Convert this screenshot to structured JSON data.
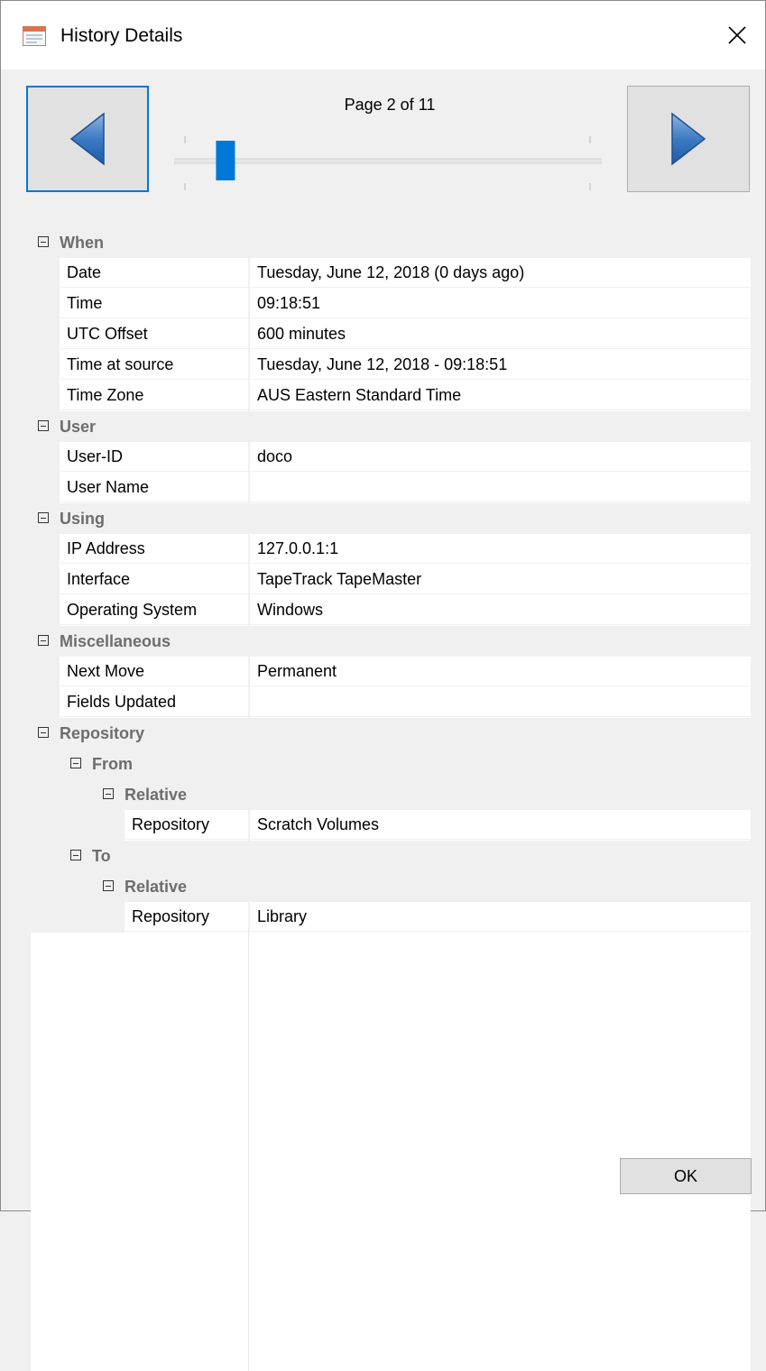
{
  "window": {
    "title": "History Details",
    "close_label": "✕"
  },
  "pager": {
    "page_label": "Page 2 of 11",
    "current_page": 2,
    "total_pages": 11
  },
  "tree": [
    {
      "type": "cat",
      "level": 0,
      "label": "When"
    },
    {
      "type": "prop",
      "level": 1,
      "name": "Date",
      "value": "Tuesday, June 12, 2018 (0 days ago)"
    },
    {
      "type": "prop",
      "level": 1,
      "name": "Time",
      "value": "09:18:51"
    },
    {
      "type": "prop",
      "level": 1,
      "name": "UTC Offset",
      "value": "600 minutes"
    },
    {
      "type": "prop",
      "level": 1,
      "name": "Time at source",
      "value": "Tuesday, June 12, 2018 - 09:18:51"
    },
    {
      "type": "prop",
      "level": 1,
      "name": "Time Zone",
      "value": "AUS Eastern Standard Time"
    },
    {
      "type": "cat",
      "level": 0,
      "label": "User"
    },
    {
      "type": "prop",
      "level": 1,
      "name": "User-ID",
      "value": "doco"
    },
    {
      "type": "prop",
      "level": 1,
      "name": "User Name",
      "value": ""
    },
    {
      "type": "cat",
      "level": 0,
      "label": "Using"
    },
    {
      "type": "prop",
      "level": 1,
      "name": "IP Address",
      "value": "127.0.0.1:1"
    },
    {
      "type": "prop",
      "level": 1,
      "name": "Interface",
      "value": "TapeTrack TapeMaster"
    },
    {
      "type": "prop",
      "level": 1,
      "name": "Operating System",
      "value": "Windows"
    },
    {
      "type": "cat",
      "level": 0,
      "label": "Miscellaneous"
    },
    {
      "type": "prop",
      "level": 1,
      "name": "Next Move",
      "value": "Permanent"
    },
    {
      "type": "prop",
      "level": 1,
      "name": "Fields Updated",
      "value": ""
    },
    {
      "type": "cat",
      "level": 0,
      "label": "Repository"
    },
    {
      "type": "cat",
      "level": 1,
      "label": "From"
    },
    {
      "type": "cat",
      "level": 2,
      "label": "Relative"
    },
    {
      "type": "prop",
      "level": 3,
      "name": "Repository",
      "value": "Scratch Volumes"
    },
    {
      "type": "cat",
      "level": 1,
      "label": "To"
    },
    {
      "type": "cat",
      "level": 2,
      "label": "Relative"
    },
    {
      "type": "prop",
      "level": 3,
      "name": "Repository",
      "value": "Library"
    }
  ],
  "buttons": {
    "ok_label": "OK"
  },
  "icons": {
    "app": "window-app-icon",
    "close": "close-icon",
    "prev": "arrow-left-icon",
    "next": "arrow-right-icon",
    "collapse": "collapse-icon"
  },
  "colors": {
    "accent": "#0078d7",
    "category_text": "#6d6d6d"
  }
}
